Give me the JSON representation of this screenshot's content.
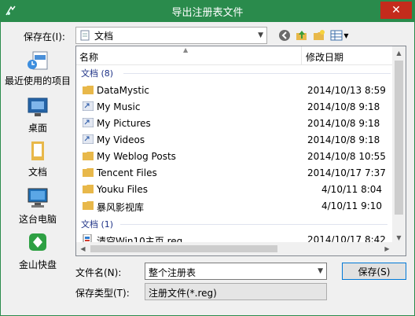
{
  "window": {
    "title": "导出注册表文件",
    "close_glyph": "✕"
  },
  "save_in": {
    "label": "保存在(I):",
    "value": "文档"
  },
  "places": [
    {
      "label": "最近使用的项目",
      "icon": "recent-places-icon"
    },
    {
      "label": "桌面",
      "icon": "desktop-icon"
    },
    {
      "label": "文档",
      "icon": "documents-icon"
    },
    {
      "label": "这台电脑",
      "icon": "this-pc-icon"
    },
    {
      "label": "金山快盘",
      "icon": "kuaipan-icon"
    }
  ],
  "columns": {
    "name": "名称",
    "date": "修改日期"
  },
  "groups": [
    {
      "label": "文档 (8)"
    },
    {
      "label": "文档 (1)"
    }
  ],
  "files": [
    {
      "name": "DataMystic",
      "date": "2014/10/13 8:59",
      "icon": "folder-icon"
    },
    {
      "name": "My Music",
      "date": "2014/10/8 9:18",
      "icon": "shortcut-folder-icon"
    },
    {
      "name": "My Pictures",
      "date": "2014/10/8 9:18",
      "icon": "shortcut-folder-icon"
    },
    {
      "name": "My Videos",
      "date": "2014/10/8 9:18",
      "icon": "shortcut-folder-icon"
    },
    {
      "name": "My Weblog Posts",
      "date": "2014/10/8 10:55",
      "icon": "folder-icon"
    },
    {
      "name": "Tencent Files",
      "date": "2014/10/17 7:37",
      "icon": "folder-icon"
    },
    {
      "name": "Youku Files",
      "date": "4/10/11 8:04",
      "icon": "folder-icon"
    },
    {
      "name": "暴风影视库",
      "date": "4/10/11 9:10",
      "icon": "folder-icon"
    },
    {
      "name": "清空Win10主页.reg",
      "date": "2014/10/17 8:42",
      "icon": "reg-file-icon"
    }
  ],
  "file_name": {
    "label": "文件名(N):",
    "value": "整个注册表"
  },
  "file_type": {
    "label": "保存类型(T):",
    "value": "注册文件(*.reg)"
  },
  "buttons": {
    "save": "保存(S)"
  },
  "colors": {
    "titlebar": "#2a8b4c",
    "folder": "#e8b84a",
    "group_text": "#1e3287",
    "close": "#c42b1c"
  }
}
